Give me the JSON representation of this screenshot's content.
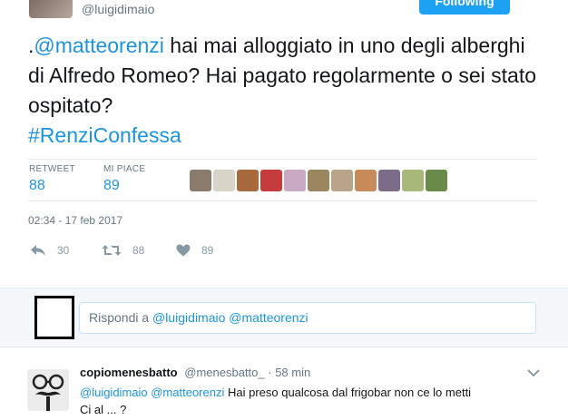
{
  "author": {
    "handle": "@luigidimaio",
    "follow_label": "Following"
  },
  "tweet": {
    "prefix": ".",
    "mention": "@matteorenzi",
    "body": " hai mai alloggiato in uno degli alberghi di Alfredo Romeo? Hai pagato regolarmente o sei stato ospitato?",
    "hashtag": "#RenziConfessa"
  },
  "stats": {
    "retweet_label": "RETWEET",
    "retweet_count": "88",
    "like_label": "MI PIACE",
    "like_count": "89"
  },
  "likers": {
    "icons": [
      "liker-avatar",
      "liker-avatar",
      "liker-avatar",
      "liker-avatar",
      "liker-avatar",
      "liker-avatar",
      "liker-avatar",
      "liker-avatar",
      "liker-avatar",
      "liker-avatar",
      "liker-avatar"
    ],
    "colors": [
      "#8a7b6c",
      "#d8d4c8",
      "#a86a3c",
      "#c63b3b",
      "#c9a9c4",
      "#9c8660",
      "#b9a48a",
      "#c98a5a",
      "#7d6b8a",
      "#a8b878",
      "#6a8a4a"
    ]
  },
  "timestamp": "02:34 - 17 feb 2017",
  "actions": {
    "reply_count": "30",
    "retweet_count": "88",
    "like_count": "89"
  },
  "reply_box": {
    "prefix": "Rispondi a ",
    "mentions": "@luigidimaio @matteorenzi"
  },
  "reply": {
    "name": "copiomenesbatto",
    "handle": "@menesbatto_",
    "separator": "·",
    "time": "58 min",
    "mentions": "@luigidimaio @matteorenzi",
    "text_line1": " Hai preso qualcosa dal frigobar non ce lo metti",
    "text_line2": "Ci al ... ?"
  },
  "colors": {
    "accent": "#1b95e0",
    "follow_btn": "#1da1f2",
    "muted": "#657786"
  }
}
